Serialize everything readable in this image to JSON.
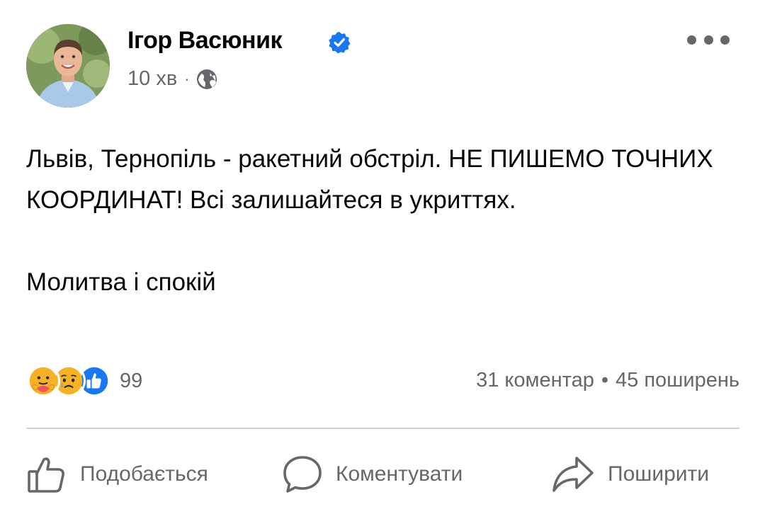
{
  "post": {
    "author": {
      "name": "Ігор Васюник",
      "verified": true,
      "avatar_icon": "profile-photo"
    },
    "meta": {
      "time": "10 хв",
      "separator": "·",
      "audience_icon": "globe-icon"
    },
    "more_icon": "more-options-icon",
    "text": {
      "paragraph1": "Львів, Тернопіль - ракетний обстріл. НЕ ПИШЕМО ТОЧНИХ КООРДИНАТ! Всі залишайтеся в укриттях.",
      "paragraph2": "Молитва і спокій"
    },
    "reactions": {
      "icons": [
        "care-reaction-icon",
        "sad-reaction-icon",
        "like-reaction-icon"
      ],
      "count": "99"
    },
    "engagement": {
      "comments": "31 коментар",
      "separator": "•",
      "shares": "45 поширень"
    },
    "actions": {
      "like_label": "Подобається",
      "comment_label": "Коментувати",
      "share_label": "Поширити"
    }
  },
  "colors": {
    "text_primary": "#050505",
    "text_secondary": "#65676b",
    "brand_blue": "#1877f2",
    "divider": "#ced0d4"
  }
}
